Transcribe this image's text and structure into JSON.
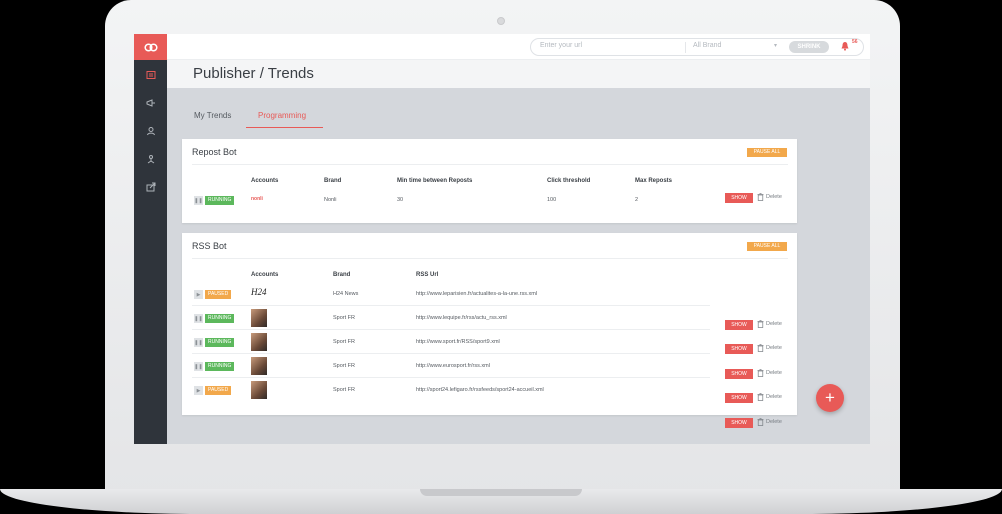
{
  "header": {
    "title": "Publisher / Trends"
  },
  "topbar": {
    "url_placeholder": "Enter your url",
    "brand_selected": "All Brand",
    "shrink_label": "SHRINK",
    "notification_count": "56"
  },
  "tabs": [
    {
      "label": "My Trends"
    },
    {
      "label": "Programming"
    }
  ],
  "colors": {
    "accent": "#e85a57",
    "running": "#5cb85c",
    "paused": "#f2a84b",
    "sidebar": "#2f343b"
  },
  "repost_bot": {
    "title": "Repost Bot",
    "pause_all": "PAUSE ALL",
    "columns": {
      "accounts": "Accounts",
      "brand": "Brand",
      "min_time": "Min time between Reposts",
      "click_threshold": "Click threshold",
      "max_reposts": "Max Reposts"
    },
    "rows": [
      {
        "status": "RUNNING",
        "account_logo": "nonli",
        "brand": "Nonli",
        "min_time": "30",
        "click_threshold": "100",
        "max_reposts": "2",
        "show": "SHOW",
        "delete": "Delete"
      }
    ]
  },
  "rss_bot": {
    "title": "RSS Bot",
    "pause_all": "PAUSE ALL",
    "columns": {
      "accounts": "Accounts",
      "brand": "Brand",
      "rss_url": "RSS Url"
    },
    "rows": [
      {
        "status": "PAUSED",
        "account_logo": "H24",
        "brand": "H24 News",
        "rss_url": "http://www.leparisien.fr/actualites-a-la-une.rss.xml",
        "show": "SHOW",
        "delete": "Delete"
      },
      {
        "status": "RUNNING",
        "brand": "Sport FR",
        "rss_url": "http://www.lequipe.fr/rss/actu_rss.xml",
        "show": "SHOW",
        "delete": "Delete"
      },
      {
        "status": "RUNNING",
        "brand": "Sport FR",
        "rss_url": "http://www.sport.fr/RSS/sport9.xml",
        "show": "SHOW",
        "delete": "Delete"
      },
      {
        "status": "RUNNING",
        "brand": "Sport FR",
        "rss_url": "http://www.eurosport.fr/rss.xml",
        "show": "SHOW",
        "delete": "Delete"
      },
      {
        "status": "PAUSED",
        "brand": "Sport FR",
        "rss_url": "http://sport24.lefigaro.fr/rssfeeds/sport24-accueil.xml",
        "show": "SHOW",
        "delete": "Delete"
      }
    ]
  },
  "fab": {
    "label": "+"
  }
}
